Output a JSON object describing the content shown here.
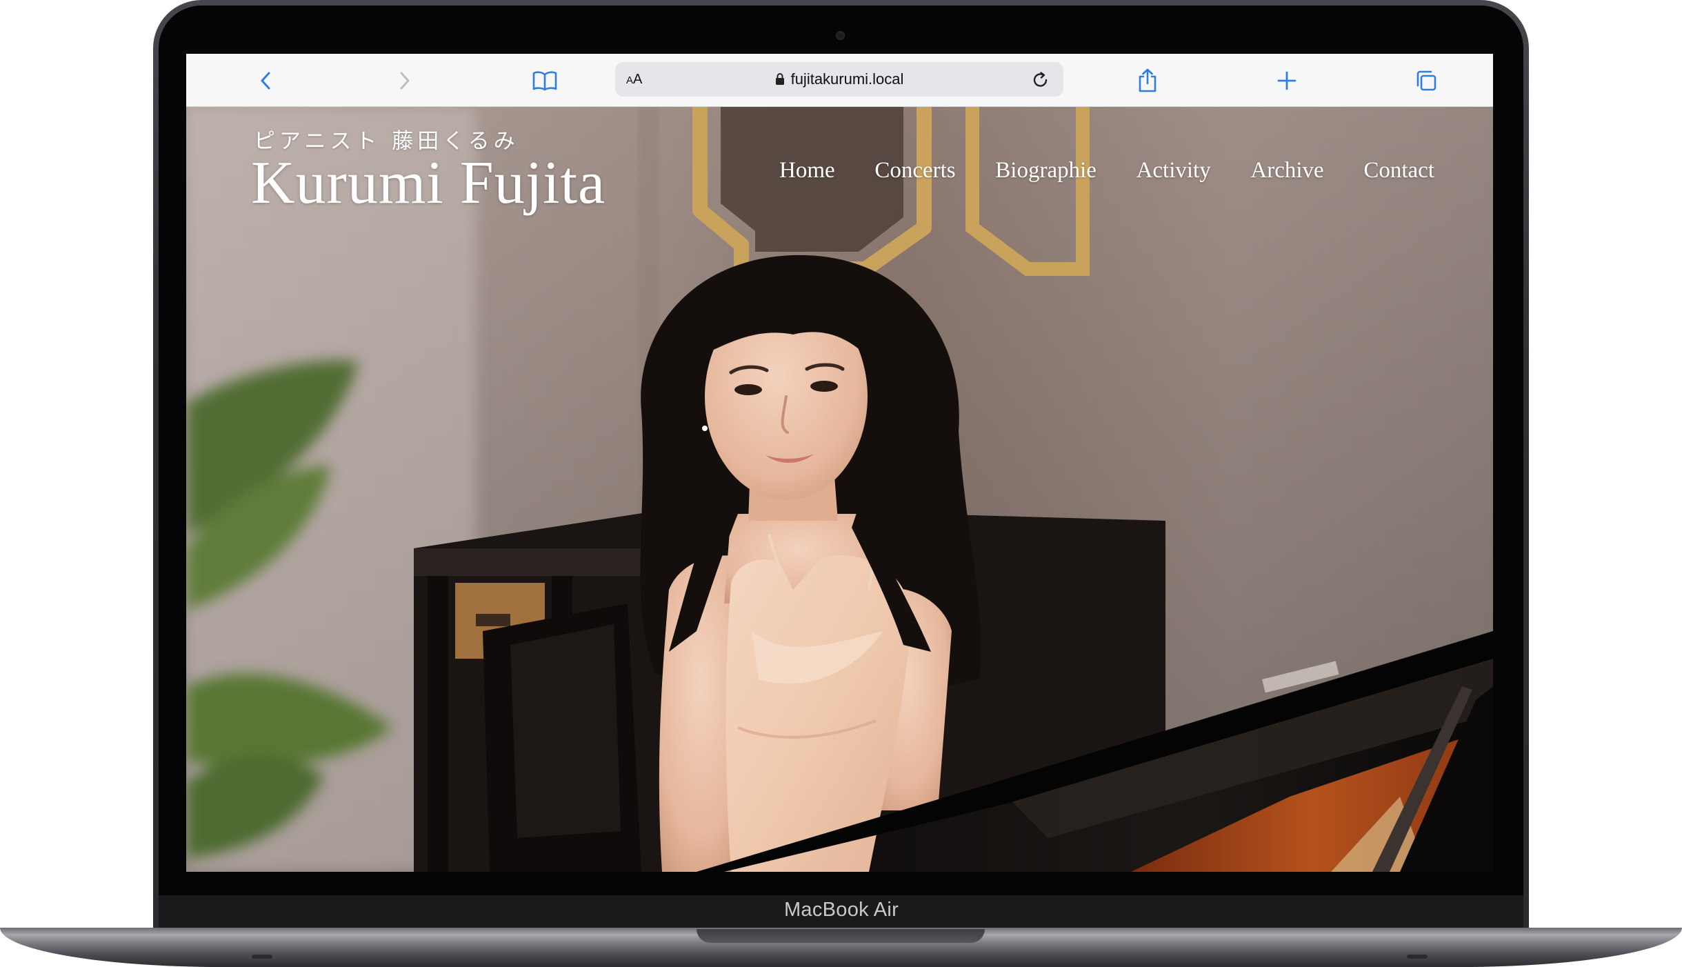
{
  "device": {
    "model_label": "MacBook Air"
  },
  "browser": {
    "reader_label_big": "A",
    "reader_label_small": "A",
    "url": "fujitakurumi.local",
    "icons": {
      "back": "chevron-left-icon",
      "forward": "chevron-right-icon",
      "bookmarks": "book-icon",
      "lock": "lock-icon",
      "reload": "reload-icon",
      "share": "share-icon",
      "new_tab": "plus-icon",
      "tabs": "tabs-icon"
    },
    "accent_color": "#1a73e8"
  },
  "site": {
    "subtitle": "ピアニスト 藤田くるみ",
    "title": "Kurumi Fujita",
    "nav": [
      {
        "label": "Home"
      },
      {
        "label": "Concerts"
      },
      {
        "label": "Biographie"
      },
      {
        "label": "Activity"
      },
      {
        "label": "Archive"
      },
      {
        "label": "Contact"
      }
    ],
    "hero_image": "pianist-portrait-photo"
  }
}
